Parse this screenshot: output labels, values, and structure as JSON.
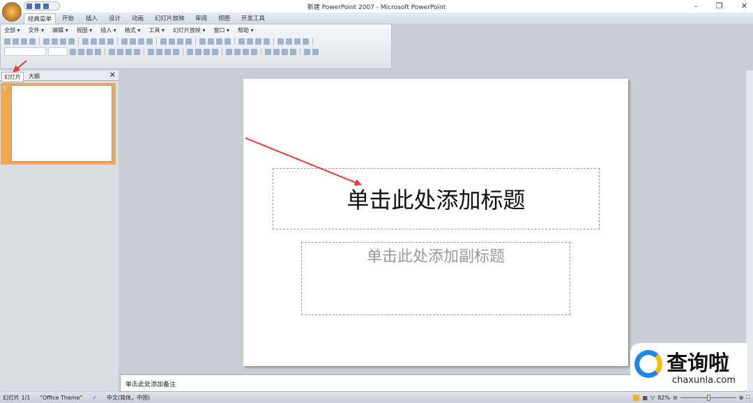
{
  "window": {
    "title": "新建 PowerPoint 2007 - Microsoft PowerPoint",
    "minimize": "–",
    "restore": "❐",
    "close": "✕"
  },
  "tabs": [
    "经典菜单",
    "开始",
    "插入",
    "设计",
    "动画",
    "幻灯片放映",
    "审阅",
    "视图",
    "开发工具"
  ],
  "menu": [
    "全部 ▾",
    "文件 ▾",
    "编辑 ▾",
    "视图 ▾",
    "插入 ▾",
    "格式 ▾",
    "工具 ▾",
    "幻灯片放映 ▾",
    "窗口 ▾",
    "帮助 ▾"
  ],
  "panel": {
    "tabs": [
      "幻灯片",
      "大纲"
    ],
    "close": "✕",
    "slide_number": "1"
  },
  "slide": {
    "title_placeholder": "单击此处添加标题",
    "subtitle_placeholder": "单击此处添加副标题"
  },
  "notes": {
    "placeholder": "单击此处添加备注"
  },
  "status": {
    "slide": "幻灯片 1/1",
    "theme": "\"Office Theme\"",
    "language": "中文(简体，中国)",
    "zoom": "82%"
  },
  "watermark": {
    "brand": "查询啦",
    "url": "chaxunla.com"
  }
}
